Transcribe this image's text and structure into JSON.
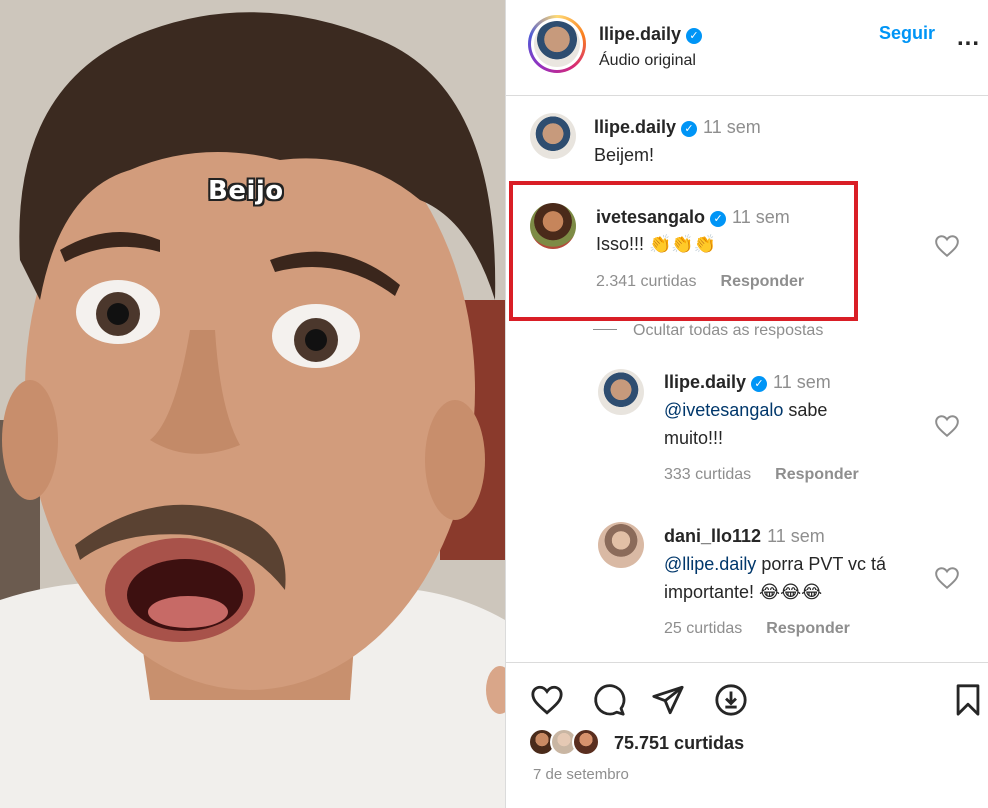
{
  "media": {
    "caption": "Beijo"
  },
  "header": {
    "username": "llipe.daily",
    "subtitle": "Áudio original",
    "follow_label": "Seguir",
    "more_label": "..."
  },
  "caption_comment": {
    "username": "llipe.daily",
    "time": "11 sem",
    "text": "Beijem!"
  },
  "comments": [
    {
      "username": "ivetesangalo",
      "time": "11 sem",
      "text": "Isso!!! 👏👏👏",
      "likes": "2.341 curtidas",
      "reply_label": "Responder"
    }
  ],
  "hide_replies_label": "Ocultar todas as respostas",
  "replies": [
    {
      "username": "llipe.daily",
      "time": "11 sem",
      "mention": "@ivetesangalo",
      "text_after_mention": " sabe",
      "text_line2": "muito!!!",
      "likes": "333 curtidas",
      "reply_label": "Responder"
    },
    {
      "username": "dani_llo112",
      "time": "11 sem",
      "mention": "@llipe.daily",
      "text_after_mention": " porra PVT vc tá",
      "text_line2": "importante! 😂😂😂",
      "likes": "25 curtidas",
      "reply_label": "Responder"
    }
  ],
  "footer": {
    "likes": "75.751 curtidas",
    "date": "7 de setembro"
  },
  "colors": {
    "accent_blue": "#0095f6",
    "highlight_red": "#d91e26",
    "mention_blue": "#00376b",
    "muted_gray": "#8e8e8e"
  }
}
